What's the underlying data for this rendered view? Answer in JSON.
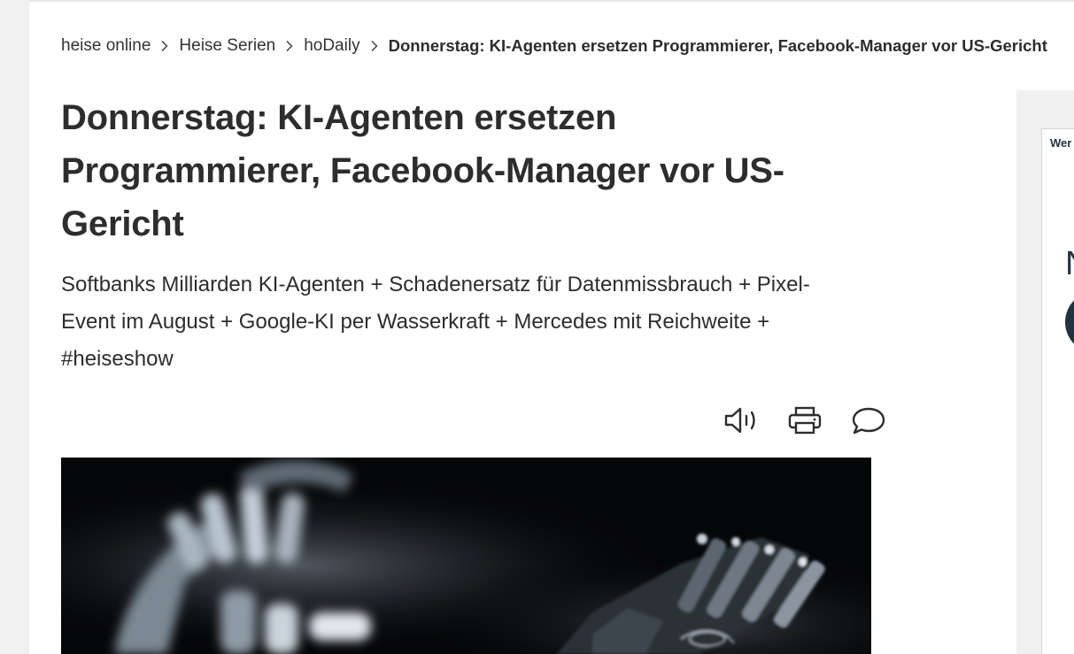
{
  "breadcrumb": {
    "items": [
      {
        "label": "heise online"
      },
      {
        "label": "Heise Serien"
      },
      {
        "label": "hoDaily"
      }
    ],
    "current": "Donnerstag: KI-Agenten ersetzen Programmierer, Facebook-Manager vor US-Gericht"
  },
  "article": {
    "headline": "Donnerstag: KI-Agenten ersetzen Programmierer, Facebook-Manager vor US-Gericht",
    "teaser": "Softbanks Milliarden KI-Agenten + Schadenersatz für Datenmissbrauch + Pixel-Event im August + Google-KI per Wasserkraft + Mercedes mit Reichweite + #heiseshow"
  },
  "tools": [
    {
      "icon": "speaker-icon"
    },
    {
      "icon": "printer-icon"
    },
    {
      "icon": "comment-icon"
    }
  ],
  "sidebar": {
    "ad_label": "Wer",
    "ad_letter": "N"
  },
  "colors": {
    "page_bg": "#f1f1f1",
    "content_bg": "#ffffff",
    "text": "#2d2d2d",
    "hero_bg": "#050607",
    "ad_dark": "#1f3340"
  }
}
